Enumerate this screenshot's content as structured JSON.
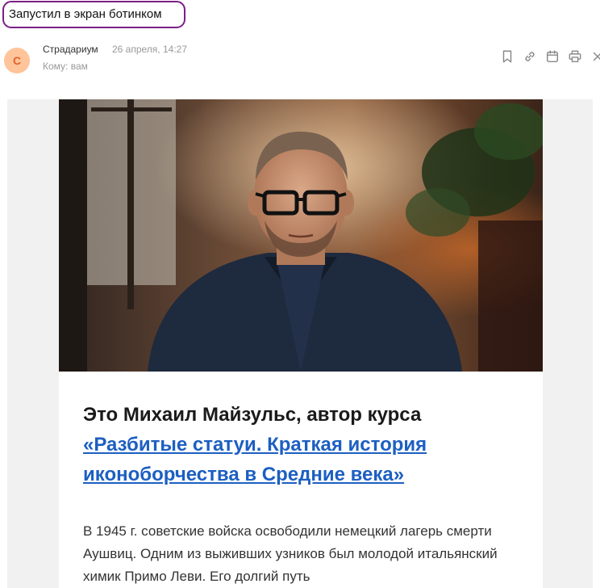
{
  "email": {
    "subject": "Запустил в экран ботинком",
    "sender_initial": "С",
    "sender_name": "Страдариум",
    "date": "26 апреля, 14:27",
    "to": "Кому: вам"
  },
  "actions": [
    {
      "icon": "bookmark-icon"
    },
    {
      "icon": "link-icon"
    },
    {
      "icon": "calendar-icon"
    },
    {
      "icon": "print-icon"
    },
    {
      "icon": "close-icon"
    }
  ],
  "body": {
    "headline_text": "Это Михаил Майзульс, автор курса",
    "headline_link": "«Разбитые статуи. Краткая история иконоборчества в Средние века»",
    "paragraph": "В 1945 г. советские войска освободили немецкий лагерь смерти Аушвиц. Одним из выживших узников был молодой итальянский химик Примо Леви. Его долгий путь"
  },
  "colors": {
    "subject_border": "#7b1f86",
    "avatar_bg": "#ffc49a",
    "avatar_text": "#e0642a",
    "link": "#1c5fc2"
  }
}
